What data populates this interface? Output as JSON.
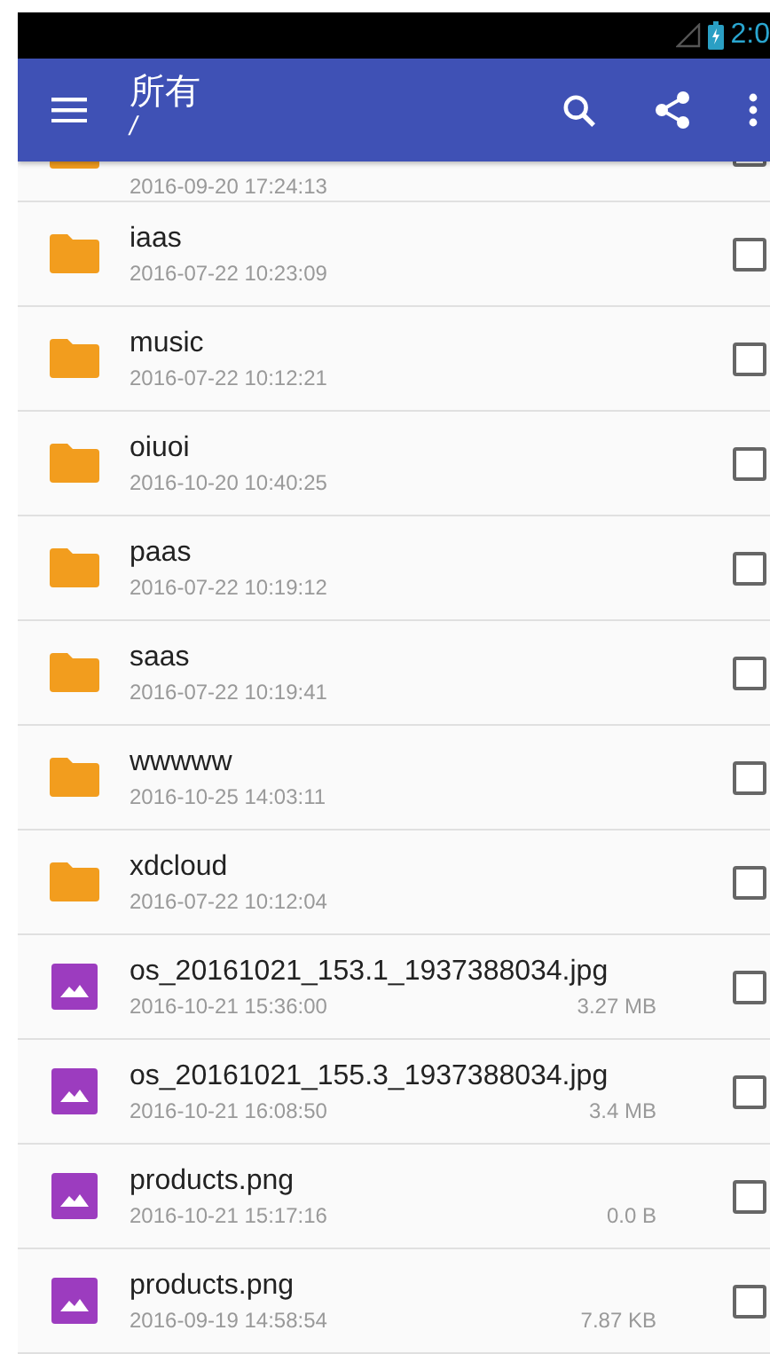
{
  "status_bar": {
    "time": "2:0"
  },
  "toolbar": {
    "title": "所有",
    "path": "/"
  },
  "files": [
    {
      "kind": "folder",
      "date": "2016-09-20 17:24:13",
      "checked": false
    },
    {
      "kind": "folder",
      "name": "iaas",
      "date": "2016-07-22 10:23:09",
      "checked": false
    },
    {
      "kind": "folder",
      "name": "music",
      "date": "2016-07-22 10:12:21",
      "checked": false
    },
    {
      "kind": "folder",
      "name": "oiuoi",
      "date": "2016-10-20 10:40:25",
      "checked": false
    },
    {
      "kind": "folder",
      "name": "paas",
      "date": "2016-07-22 10:19:12",
      "checked": false
    },
    {
      "kind": "folder",
      "name": "saas",
      "date": "2016-07-22 10:19:41",
      "checked": false
    },
    {
      "kind": "folder",
      "name": "wwwww",
      "date": "2016-10-25 14:03:11",
      "checked": false
    },
    {
      "kind": "folder",
      "name": "xdcloud",
      "date": "2016-07-22 10:12:04",
      "checked": false
    },
    {
      "kind": "image",
      "name": "os_20161021_153.1_1937388034.jpg",
      "date": "2016-10-21 15:36:00",
      "size": "3.27 MB",
      "checked": false
    },
    {
      "kind": "image",
      "name": "os_20161021_155.3_1937388034.jpg",
      "date": "2016-10-21 16:08:50",
      "size": "3.4 MB",
      "checked": false
    },
    {
      "kind": "image",
      "name": "products.png",
      "date": "2016-10-21 15:17:16",
      "size": "0.0 B",
      "checked": false
    },
    {
      "kind": "image",
      "name": "products.png",
      "date": "2016-09-19 14:58:54",
      "size": "7.87 KB",
      "checked": false
    }
  ]
}
